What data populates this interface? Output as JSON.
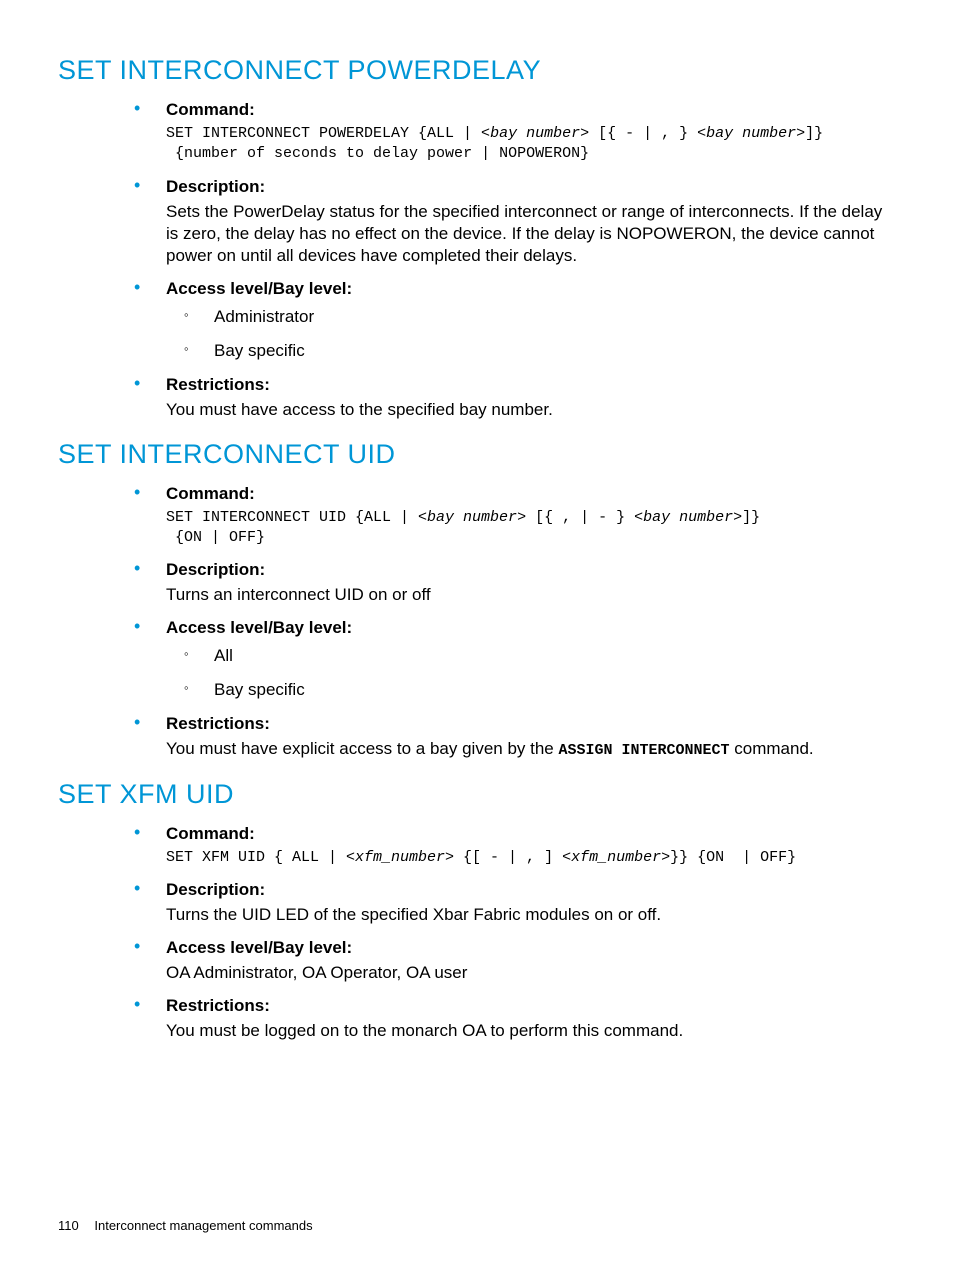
{
  "sections": [
    {
      "title": "SET INTERCONNECT POWERDELAY",
      "items": {
        "command_label": "Command:",
        "command_code_pre": "SET INTERCONNECT POWERDELAY {ALL | <",
        "command_code_it1": "bay number",
        "command_code_mid": "> [{ - | , } <",
        "command_code_it2": "bay number",
        "command_code_post": ">]}\n {number of seconds to delay power | NOPOWERON}",
        "description_label": "Description:",
        "description_text": "Sets the PowerDelay status for the specified interconnect or range of interconnects. If the delay is zero, the delay has no effect on the device. If the delay is NOPOWERON, the device cannot power on until all devices have completed their delays.",
        "access_label": "Access level/Bay level:",
        "access_items": [
          "Administrator",
          "Bay specific"
        ],
        "restrictions_label": "Restrictions:",
        "restrictions_text": "You must have access to the specified bay number."
      }
    },
    {
      "title": "SET INTERCONNECT UID",
      "items": {
        "command_label": "Command:",
        "command_code_pre": "SET INTERCONNECT UID {ALL | <",
        "command_code_it1": "bay number",
        "command_code_mid": "> [{ , | - } <",
        "command_code_it2": "bay number",
        "command_code_post": ">]}\n {ON | OFF}",
        "description_label": "Description:",
        "description_text": "Turns an interconnect UID on or off",
        "access_label": "Access level/Bay level:",
        "access_items": [
          "All",
          "Bay specific"
        ],
        "restrictions_label": "Restrictions:",
        "restrictions_pre": "You must have explicit access to a bay given by the ",
        "restrictions_code": "ASSIGN INTERCONNECT",
        "restrictions_post": " command."
      }
    },
    {
      "title": "SET XFM UID",
      "items": {
        "command_label": "Command:",
        "command_code_pre": "SET XFM UID { ALL | <",
        "command_code_it1": "xfm_number",
        "command_code_mid": "> {[ - | , ] <",
        "command_code_it2": "xfm_number",
        "command_code_post": ">}} {ON  | OFF}",
        "description_label": "Description:",
        "description_text": "Turns the UID LED of the specified Xbar Fabric modules on or off.",
        "access_label": "Access level/Bay level:",
        "access_text": "OA Administrator, OA Operator, OA user",
        "restrictions_label": "Restrictions:",
        "restrictions_text": "You must be logged on to the monarch OA to perform this command."
      }
    }
  ],
  "footer": {
    "page_number": "110",
    "chapter": "Interconnect management commands"
  }
}
